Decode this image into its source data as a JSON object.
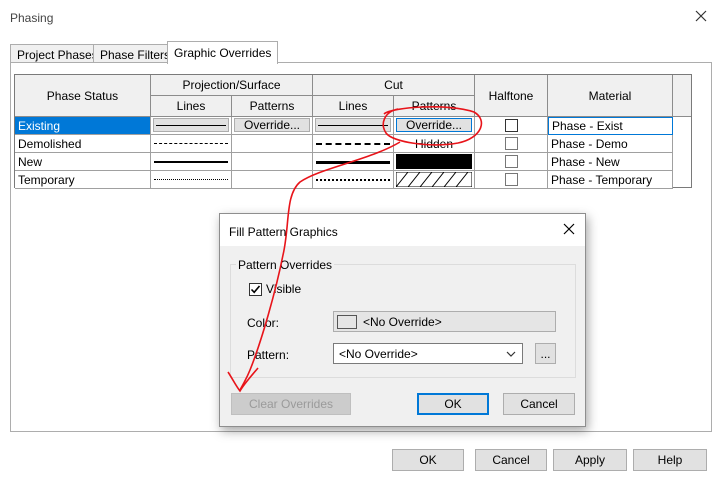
{
  "window": {
    "title": "Phasing"
  },
  "tabs": [
    {
      "label": "Project Phases"
    },
    {
      "label": "Phase Filters"
    },
    {
      "label": "Graphic Overrides"
    }
  ],
  "grid": {
    "headers": {
      "phase_status": "Phase Status",
      "projection_surface": "Projection/Surface",
      "cut": "Cut",
      "halftone": "Halftone",
      "material": "Material",
      "lines": "Lines",
      "patterns": "Patterns"
    },
    "rows": [
      {
        "status": "Existing",
        "proj_lines": "thin",
        "proj_patterns": "Override...",
        "cut_lines": "thin",
        "cut_patterns": "Override...",
        "halftone": false,
        "material": "Phase - Exist",
        "selected": true
      },
      {
        "status": "Demolished",
        "proj_lines": "dashed",
        "proj_patterns": "",
        "cut_lines": "dashed-thick",
        "cut_patterns": "Hidden",
        "halftone": false,
        "material": "Phase - Demo"
      },
      {
        "status": "New",
        "proj_lines": "thick",
        "proj_patterns": "",
        "cut_lines": "thick",
        "cut_patterns": "solid-black",
        "halftone": false,
        "material": "Phase - New"
      },
      {
        "status": "Temporary",
        "proj_lines": "dotted",
        "proj_patterns": "",
        "cut_lines": "dotted",
        "cut_patterns": "diagonal-hatch",
        "halftone": false,
        "material": "Phase - Temporary"
      }
    ]
  },
  "fill_dialog": {
    "title": "Fill Pattern Graphics",
    "group": "Pattern Overrides",
    "visible_label": "Visible",
    "visible_checked": true,
    "color_label": "Color:",
    "color_value": "<No Override>",
    "pattern_label": "Pattern:",
    "pattern_value": "<No Override>",
    "ellipsis": "...",
    "clear_overrides": "Clear Overrides",
    "ok": "OK",
    "cancel": "Cancel"
  },
  "footer": {
    "ok": "OK",
    "cancel": "Cancel",
    "apply": "Apply",
    "help": "Help"
  },
  "colors": {
    "selection": "#0078d7",
    "annotation": "#e8141a",
    "dialog_bg": "#f0f0f0"
  }
}
